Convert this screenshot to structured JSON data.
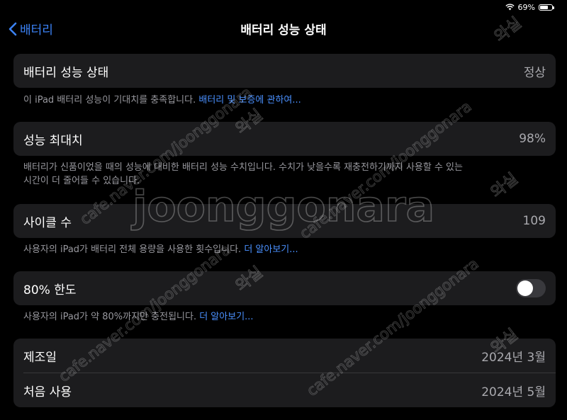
{
  "status_bar": {
    "battery_percent": "69%",
    "battery_level": 0.69
  },
  "nav": {
    "back_label": "배터리",
    "title": "배터리 성능 상태"
  },
  "battery_health": {
    "label": "배터리 성능 상태",
    "value": "정상",
    "desc": "이 iPad 배터리 성능이 기대치를 충족합니다. ",
    "link": "배터리 및 보증에 관하여..."
  },
  "max_capacity": {
    "label": "성능 최대치",
    "value": "98%",
    "desc_line1": "배터리가 신품이었을 때의 성능에 대비한 배터리 성능 수치입니다. 수치가 낮을수록 재충전하기까지 사용할 수 있는",
    "desc_line2": "시간이 더 줄어들 수 있습니다."
  },
  "cycle_count": {
    "label": "사이클 수",
    "value": "109",
    "desc": "사용자의 iPad가 배터리 전체 용량을 사용한 횟수입니다. ",
    "link": "더 알아보기..."
  },
  "limit_80": {
    "label": "80% 한도",
    "enabled": false,
    "desc": "사용자의 iPad가 약 80%까지만 충전됩니다. ",
    "link": "더 알아보기..."
  },
  "dates": {
    "manufactured_label": "제조일",
    "manufactured_value": "2024년 3월",
    "first_use_label": "처음 사용",
    "first_use_value": "2024년 5월"
  },
  "watermark": {
    "brand": "joonggonara",
    "url": "cafe.naver.com/joonggonara",
    "seller": "와실"
  }
}
